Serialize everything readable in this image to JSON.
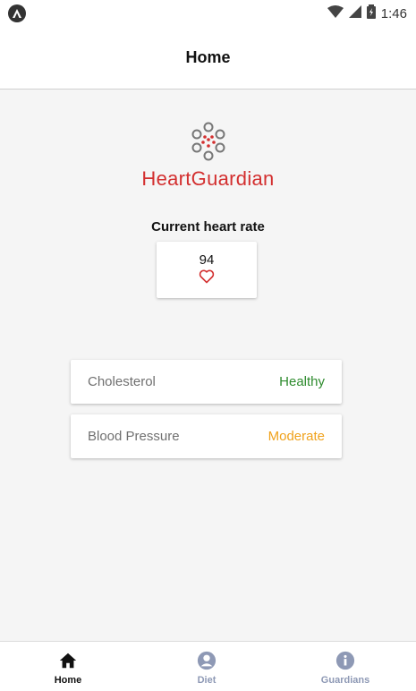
{
  "status_bar": {
    "time": "1:46"
  },
  "header": {
    "title": "Home"
  },
  "logo": {
    "text": "HeartGuardian"
  },
  "heart_rate": {
    "label": "Current heart rate",
    "value": "94"
  },
  "stats": [
    {
      "name": "Cholesterol",
      "status": "Healthy",
      "color": "#2e8b2e"
    },
    {
      "name": "Blood Pressure",
      "status": "Moderate",
      "color": "#f0a21c"
    }
  ],
  "bottom_nav": {
    "items": [
      {
        "label": "Home",
        "icon": "home-icon",
        "active": true
      },
      {
        "label": "Diet",
        "icon": "person-icon",
        "active": false
      },
      {
        "label": "Guardians",
        "icon": "info-icon",
        "active": false
      }
    ]
  },
  "colors": {
    "brand": "#d32f2f",
    "active_nav": "#111111",
    "inactive_nav": "#8e99b5"
  }
}
